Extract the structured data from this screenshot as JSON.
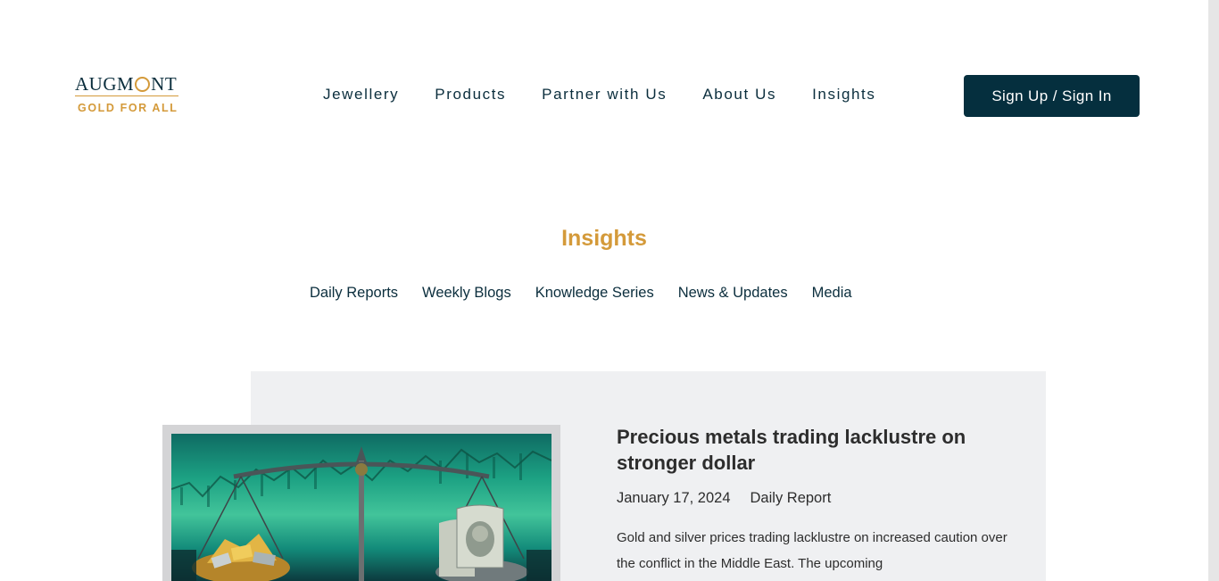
{
  "header": {
    "logo": {
      "brand": "AUGMONT",
      "tagline": "GOLD FOR ALL"
    },
    "nav": [
      "Jewellery",
      "Products",
      "Partner with Us",
      "About Us",
      "Insights"
    ],
    "signin_label": "Sign Up / Sign In"
  },
  "insights": {
    "title": "Insights",
    "tabs": [
      "Daily Reports",
      "Weekly Blogs",
      "Knowledge Series",
      "News & Updates",
      "Media"
    ]
  },
  "article": {
    "title": "Precious metals trading lacklustre on stronger dollar",
    "date": "January 17, 2024",
    "category": "Daily Report",
    "excerpt": "Gold and silver prices trading lacklustre on increased caution over the conflict in the Middle East. The upcoming"
  },
  "colors": {
    "accent_gold": "#d49a3a",
    "navy": "#052f3e",
    "card_bg": "#eff0f2"
  }
}
